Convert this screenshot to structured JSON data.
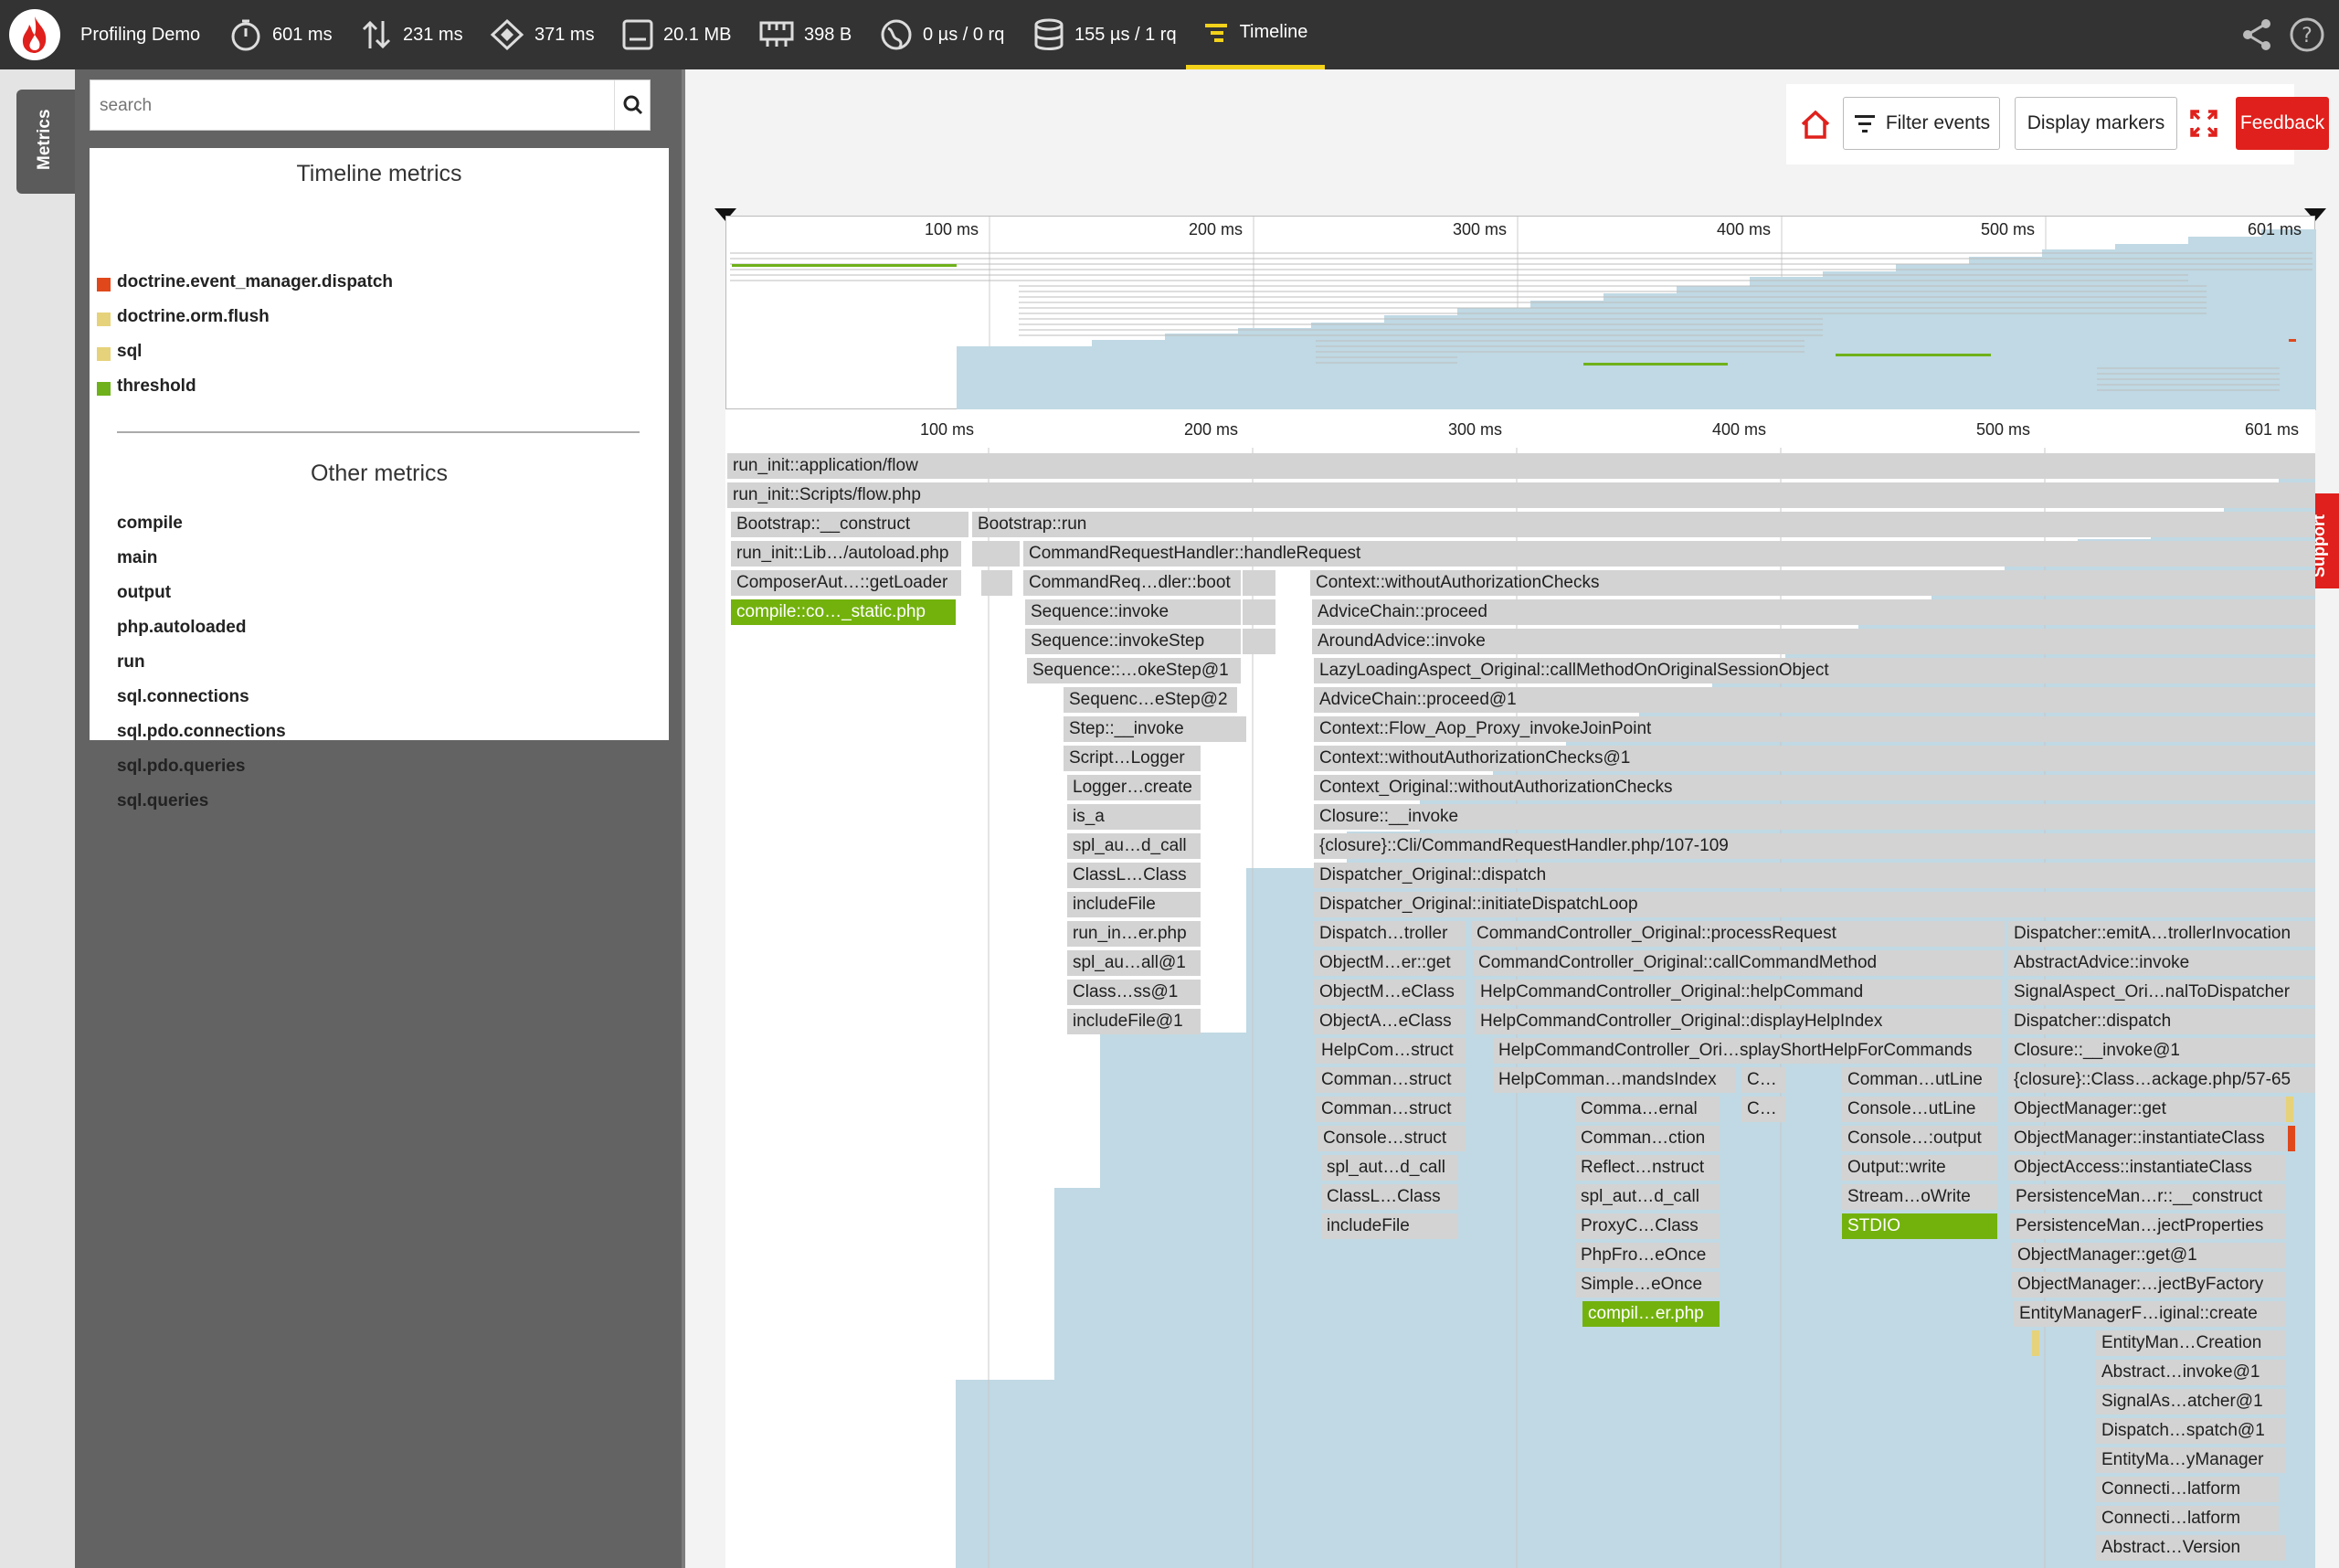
{
  "topbar": {
    "app_name": "Profiling Demo",
    "stats": [
      {
        "icon": "stopwatch-icon",
        "value": "601 ms"
      },
      {
        "icon": "io-wait-arrows-icon",
        "value": "231 ms"
      },
      {
        "icon": "cpu-icon",
        "value": "371 ms"
      },
      {
        "icon": "memory-icon",
        "value": "20.1 MB"
      },
      {
        "icon": "network-icon",
        "value": "398 B"
      },
      {
        "icon": "http-globe-icon",
        "value": "0 µs / 0 rq"
      },
      {
        "icon": "database-icon",
        "value": "155 µs / 1 rq"
      }
    ],
    "active_tab": "Timeline"
  },
  "sidebar": {
    "tab_label": "Metrics",
    "search_placeholder": "search",
    "timeline_title": "Timeline metrics",
    "timeline_metrics": [
      {
        "label": "doctrine.event_manager.dispatch",
        "color": "#e0481c"
      },
      {
        "label": "doctrine.orm.flush",
        "color": "#e6d27a"
      },
      {
        "label": "sql",
        "color": "#e6d27a"
      },
      {
        "label": "threshold",
        "color": "#6fb11a"
      }
    ],
    "other_title": "Other metrics",
    "other_metrics": [
      "compile",
      "main",
      "output",
      "php.autoloaded",
      "run",
      "sql.connections",
      "sql.pdo.connections",
      "sql.pdo.queries",
      "sql.queries"
    ]
  },
  "toolbar": {
    "filter_label": "Filter events",
    "markers_label": "Display markers",
    "feedback_label": "Feedback"
  },
  "support_label": "Support",
  "timeline": {
    "ticks": [
      "100 ms",
      "200 ms",
      "300 ms",
      "400 ms",
      "500 ms",
      "601 ms"
    ],
    "colors": {
      "frame": "#d3d3d3",
      "highlight": "#73b20d",
      "area": "#c0d9e4"
    },
    "frames": [
      {
        "label": "run_init::application/flow"
      },
      {
        "label": "run_init::Scripts/flow.php"
      },
      {
        "label": "Bootstrap::__construct"
      },
      {
        "label": "Bootstrap::run"
      },
      {
        "label": "run_init::Lib…/autoload.php"
      },
      {
        "label": "CommandRequestHandler::handleRequest"
      },
      {
        "label": "ComposerAut…::getLoader"
      },
      {
        "label": "CommandReq…dler::boot"
      },
      {
        "label": "Context::withoutAuthorizationChecks"
      },
      {
        "label": "compile::co…_static.php"
      },
      {
        "label": "Sequence::invoke"
      },
      {
        "label": "AdviceChain::proceed"
      },
      {
        "label": "Sequence::invokeStep"
      },
      {
        "label": "AroundAdvice::invoke"
      },
      {
        "label": "Sequence::…okeStep@1"
      },
      {
        "label": "LazyLoadingAspect_Original::callMethodOnOriginalSessionObject"
      },
      {
        "label": "Sequenc…eStep@2"
      },
      {
        "label": "AdviceChain::proceed@1"
      },
      {
        "label": "Step::__invoke"
      },
      {
        "label": "Context::Flow_Aop_Proxy_invokeJoinPoint"
      },
      {
        "label": "Script…Logger"
      },
      {
        "label": "Context::withoutAuthorizationChecks@1"
      },
      {
        "label": "Logger…create"
      },
      {
        "label": "Context_Original::withoutAuthorizationChecks"
      },
      {
        "label": "is_a"
      },
      {
        "label": "Closure::__invoke"
      },
      {
        "label": "spl_au…d_call"
      },
      {
        "label": "{closure}::Cli/CommandRequestHandler.php/107-109"
      },
      {
        "label": "ClassL…Class"
      },
      {
        "label": "Dispatcher_Original::dispatch"
      },
      {
        "label": "includeFile"
      },
      {
        "label": "Dispatcher_Original::initiateDispatchLoop"
      },
      {
        "label": "run_in…er.php"
      },
      {
        "label": "Dispatch…troller"
      },
      {
        "label": "CommandController_Original::processRequest"
      },
      {
        "label": "Dispatcher::emitA…trollerInvocation"
      },
      {
        "label": "spl_au…all@1"
      },
      {
        "label": "ObjectM…er::get"
      },
      {
        "label": "CommandController_Original::callCommandMethod"
      },
      {
        "label": "AbstractAdvice::invoke"
      },
      {
        "label": "Class…ss@1"
      },
      {
        "label": "ObjectM…eClass"
      },
      {
        "label": "HelpCommandController_Original::helpCommand"
      },
      {
        "label": "SignalAspect_Ori…nalToDispatcher"
      },
      {
        "label": "includeFile@1"
      },
      {
        "label": "ObjectA…eClass"
      },
      {
        "label": "HelpCommandController_Original::displayHelpIndex"
      },
      {
        "label": "Dispatcher::dispatch"
      },
      {
        "label": "HelpCom…struct"
      },
      {
        "label": "HelpCommandController_Ori…splayShortHelpForCommands"
      },
      {
        "label": "Closure::__invoke@1"
      },
      {
        "label": "Comman…struct"
      },
      {
        "label": "HelpComman…mandsIndex"
      },
      {
        "label": "C…"
      },
      {
        "label": "Comman…utLine"
      },
      {
        "label": "{closure}::Class…ackage.php/57-65"
      },
      {
        "label": "Comman…struct"
      },
      {
        "label": "Comma…ernal"
      },
      {
        "label": "C…"
      },
      {
        "label": "Console…utLine"
      },
      {
        "label": "ObjectManager::get"
      },
      {
        "label": "Console…struct"
      },
      {
        "label": "Comman…ction"
      },
      {
        "label": "Console…:output"
      },
      {
        "label": "ObjectManager::instantiateClass"
      },
      {
        "label": "spl_aut…d_call"
      },
      {
        "label": "Reflect…nstruct"
      },
      {
        "label": "Output::write"
      },
      {
        "label": "ObjectAccess::instantiateClass"
      },
      {
        "label": "ClassL…Class"
      },
      {
        "label": "spl_aut…d_call"
      },
      {
        "label": "Stream…oWrite"
      },
      {
        "label": "PersistenceMan…r::__construct"
      },
      {
        "label": "includeFile"
      },
      {
        "label": "ProxyC…Class"
      },
      {
        "label": "STDIO"
      },
      {
        "label": "PersistenceMan…jectProperties"
      },
      {
        "label": "PhpFro…eOnce"
      },
      {
        "label": "ObjectManager::get@1"
      },
      {
        "label": "Simple…eOnce"
      },
      {
        "label": "ObjectManager:…jectByFactory"
      },
      {
        "label": "compil…er.php"
      },
      {
        "label": "EntityManagerF…iginal::create"
      },
      {
        "label": "EntityMan…Creation"
      },
      {
        "label": "Abstract…invoke@1"
      },
      {
        "label": "SignalAs…atcher@1"
      },
      {
        "label": "Dispatch…spatch@1"
      },
      {
        "label": "EntityMa…yManager"
      },
      {
        "label": "Connecti…latform"
      },
      {
        "label": "Connecti…latform"
      },
      {
        "label": "Abstract…Version"
      }
    ]
  }
}
